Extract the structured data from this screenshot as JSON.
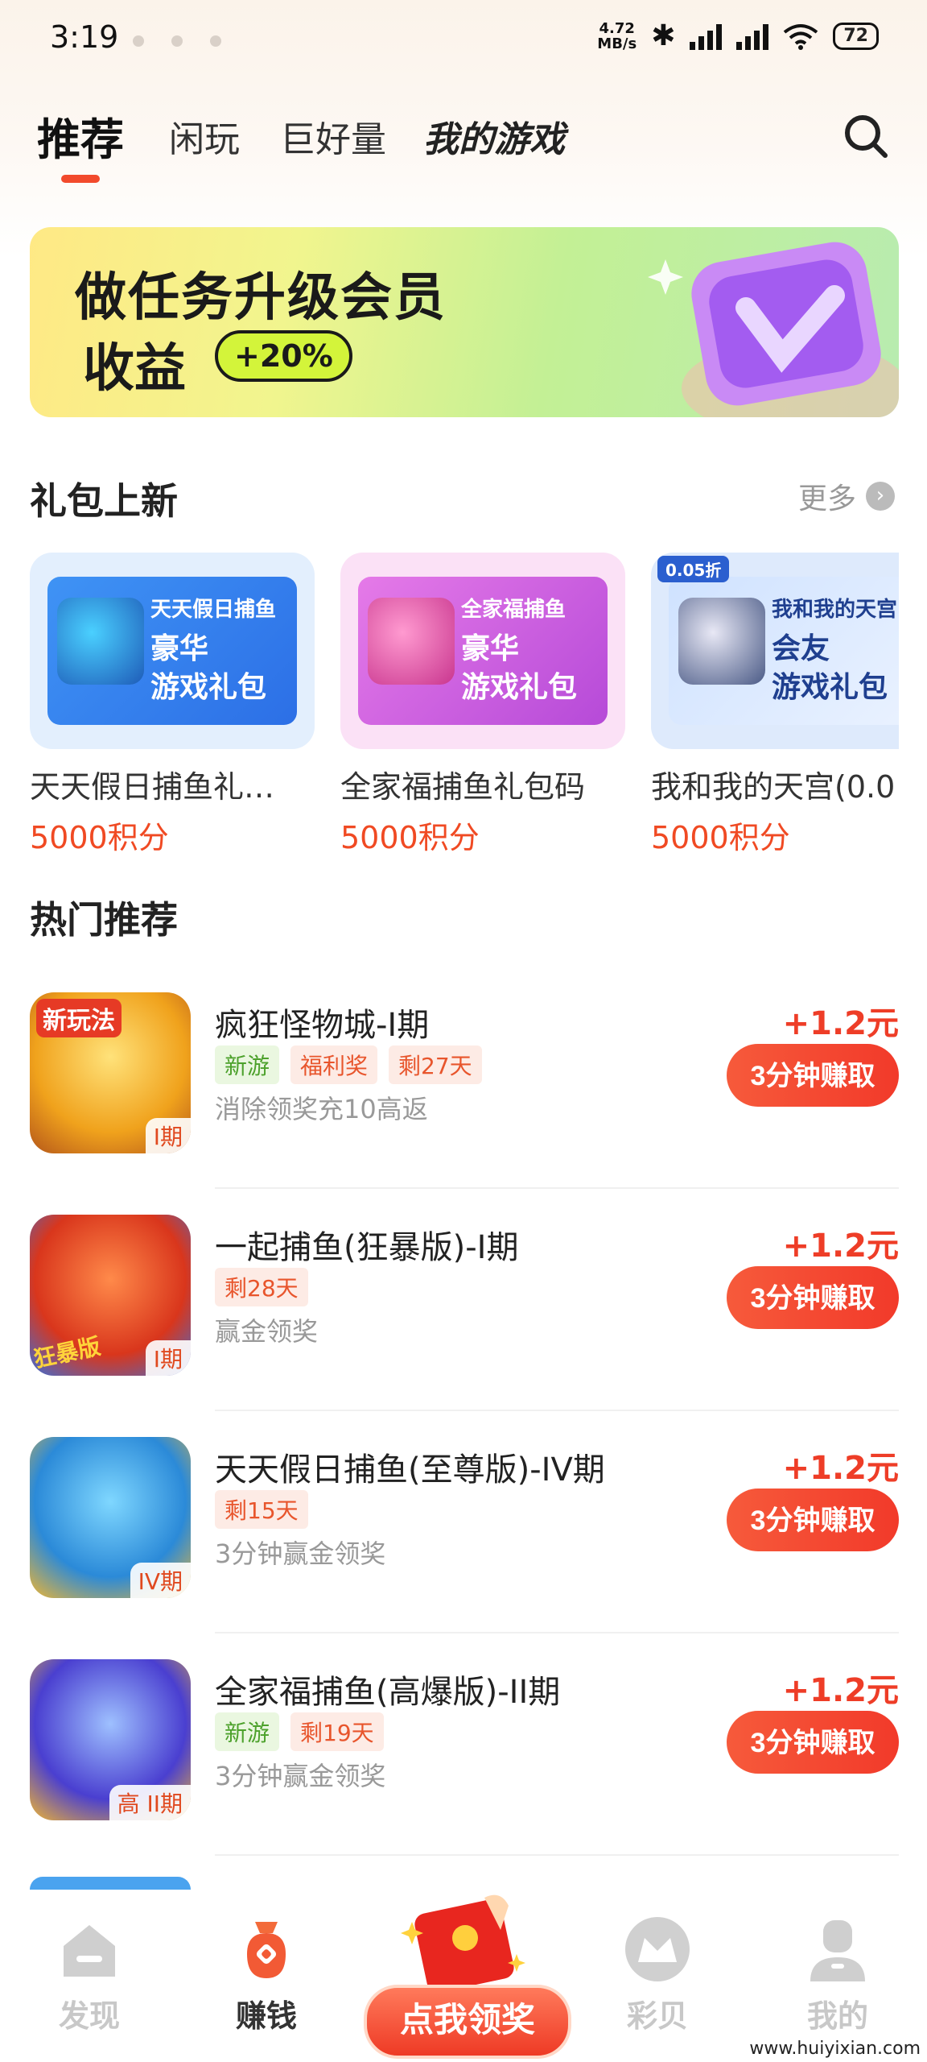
{
  "status": {
    "time": "3:19",
    "net_speed_value": "4.72",
    "net_speed_unit": "MB/s",
    "battery": "72"
  },
  "tabs": [
    {
      "label": "推荐",
      "active": true
    },
    {
      "label": "闲玩"
    },
    {
      "label": "巨好量"
    },
    {
      "label": "我的游戏"
    }
  ],
  "banner": {
    "title": "做任务升级会员",
    "subtitle": "收益",
    "percent": "+20%"
  },
  "gift_section": {
    "title": "礼包上新",
    "more_label": "更多",
    "items": [
      {
        "card_game": "天天假日捕鱼",
        "card_line1": "豪华",
        "card_line2": "游戏礼包",
        "name": "天天假日捕鱼礼…",
        "price": "5000积分"
      },
      {
        "card_game": "全家福捕鱼",
        "card_line1": "豪华",
        "card_line2": "游戏礼包",
        "name": "全家福捕鱼礼包码",
        "price": "5000积分"
      },
      {
        "card_game": "我和我的天宫",
        "card_line1": "会友",
        "card_line2": "游戏礼包",
        "card_tag": "0.05折",
        "name": "我和我的天宫(0.0",
        "price": "5000积分"
      }
    ]
  },
  "hot_section": {
    "title": "热门推荐",
    "items": [
      {
        "name": "疯狂怪物城-I期",
        "badge": "I期",
        "icon_text": "新玩法",
        "tags": [
          {
            "text": "新游",
            "color": "green"
          },
          {
            "text": "福利奖",
            "color": "red"
          },
          {
            "text": "剩27天",
            "color": "red"
          }
        ],
        "desc": "消除领奖充10高返",
        "reward": "+1.2元",
        "button": "3分钟赚取"
      },
      {
        "name": "一起捕鱼(狂暴版)-I期",
        "badge": "I期",
        "icon_text": "狂暴版",
        "tags": [
          {
            "text": "剩28天",
            "color": "red"
          }
        ],
        "desc": "赢金领奖",
        "reward": "+1.2元",
        "button": "3分钟赚取"
      },
      {
        "name": "天天假日捕鱼(至尊版)-IV期",
        "badge": "IV期",
        "tags": [
          {
            "text": "剩15天",
            "color": "red"
          }
        ],
        "desc": "3分钟赢金领奖",
        "reward": "+1.2元",
        "button": "3分钟赚取"
      },
      {
        "name": "全家福捕鱼(高爆版)-II期",
        "badge": "高 II期",
        "tags": [
          {
            "text": "新游",
            "color": "green"
          },
          {
            "text": "剩19天",
            "color": "red"
          }
        ],
        "desc": "3分钟赢金领奖",
        "reward": "+1.2元",
        "button": "3分钟赚取"
      }
    ]
  },
  "bottom_nav": {
    "items": [
      {
        "label": "发现"
      },
      {
        "label": "赚钱",
        "active": true
      },
      {
        "label": "彩贝"
      },
      {
        "label": "我的"
      }
    ],
    "center_label": "点我领奖"
  },
  "watermark": "www.huiyixian.com",
  "colors": {
    "accent": "#f04a23",
    "button": "#f23a2a",
    "tag_green": "#4ca12b"
  }
}
